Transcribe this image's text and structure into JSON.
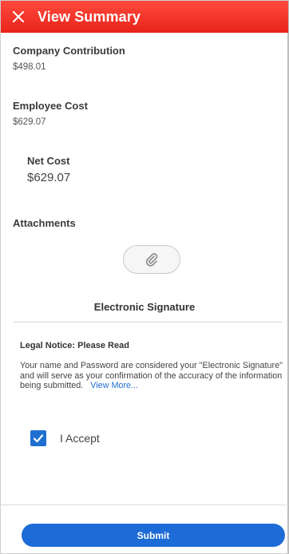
{
  "header": {
    "title": "View Summary",
    "close_icon": "close-icon",
    "background_color": "#e8231a"
  },
  "summary": {
    "company_contribution": {
      "label": "Company Contribution",
      "value": "$498.01"
    },
    "employee_cost": {
      "label": "Employee Cost",
      "value": "$629.07"
    },
    "net_cost": {
      "label": "Net Cost",
      "value": "$629.07"
    }
  },
  "attachments": {
    "label": "Attachments",
    "button_icon": "paperclip-icon"
  },
  "signature": {
    "title": "Electronic Signature",
    "notice_title": "Legal Notice: Please Read",
    "notice_text": "Your name and Password are considered your \"Electronic Signature\" and will serve as your confirmation of the accuracy of the information being submitted.",
    "view_more": "View More...",
    "accept_label": "I Accept",
    "accept_checked": true
  },
  "footer": {
    "submit_label": "Submit",
    "accent_color": "#1d6bd6"
  }
}
